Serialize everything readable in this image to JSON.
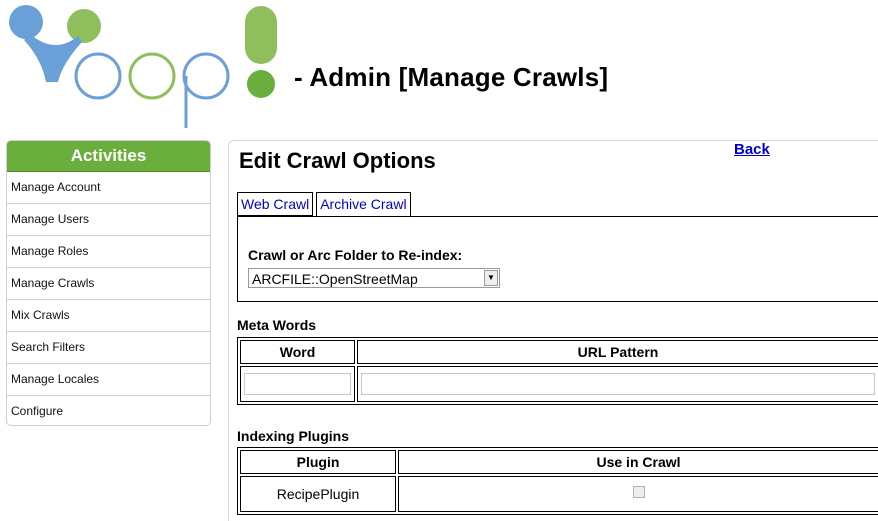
{
  "header": {
    "title": "- Admin [Manage Crawls]",
    "logo_colors": {
      "blue": "#6b9fd8",
      "green": "#8fbf5d",
      "dark_green": "#6aaf3d"
    }
  },
  "sidebar": {
    "title": "Activities",
    "items": [
      {
        "label": "Manage Account"
      },
      {
        "label": "Manage Users"
      },
      {
        "label": "Manage Roles"
      },
      {
        "label": "Manage Crawls"
      },
      {
        "label": "Mix Crawls"
      },
      {
        "label": "Search Filters"
      },
      {
        "label": "Manage Locales"
      },
      {
        "label": "Configure"
      }
    ]
  },
  "main": {
    "title": "Edit Crawl Options",
    "back_label": "Back",
    "tabs": [
      {
        "label": "Web Crawl",
        "active": false
      },
      {
        "label": "Archive Crawl",
        "active": true
      }
    ],
    "crawl_field": {
      "label": "Crawl or Arc Folder to Re-index:",
      "selected": "ARCFILE::OpenStreetMap"
    },
    "meta_words": {
      "title": "Meta Words",
      "headers": [
        "Word",
        "URL Pattern"
      ],
      "row": {
        "word": "",
        "url_pattern": ""
      }
    },
    "indexing_plugins": {
      "title": "Indexing Plugins",
      "headers": [
        "Plugin",
        "Use in Crawl"
      ],
      "rows": [
        {
          "plugin": "RecipePlugin",
          "use": false
        }
      ]
    }
  }
}
